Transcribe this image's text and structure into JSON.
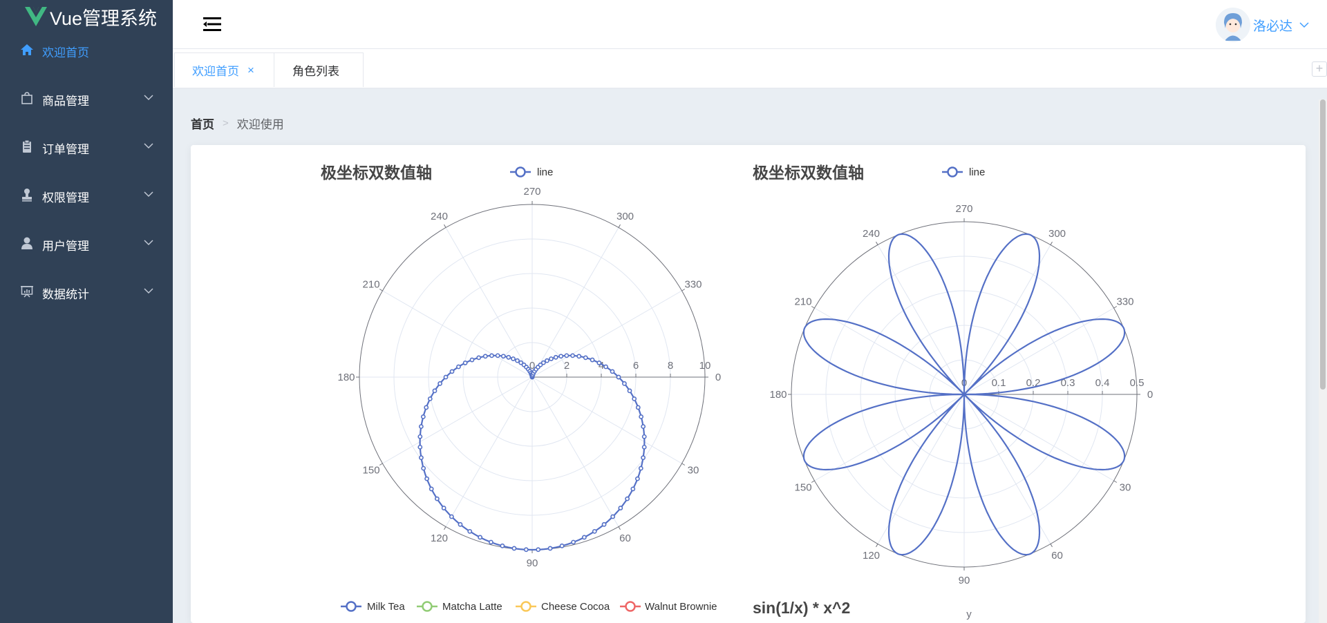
{
  "app": {
    "title": "Vue管理系统"
  },
  "sidebar": {
    "items": [
      {
        "label": "欢迎首页",
        "icon": "home-icon",
        "active": true
      },
      {
        "label": "商品管理",
        "icon": "shopping-bag-icon"
      },
      {
        "label": "订单管理",
        "icon": "clipboard-icon"
      },
      {
        "label": "权限管理",
        "icon": "stamp-icon"
      },
      {
        "label": "用户管理",
        "icon": "user-icon"
      },
      {
        "label": "数据统计",
        "icon": "presentation-chart-icon"
      }
    ]
  },
  "header": {
    "user_name": "洛必达"
  },
  "tabs": [
    {
      "label": "欢迎首页",
      "active": true,
      "closable": true
    },
    {
      "label": "角色列表"
    }
  ],
  "breadcrumb": {
    "home": "首页",
    "current": "欢迎使用"
  },
  "colors": {
    "sidebar_bg": "#304156",
    "accent": "#409eff",
    "series": "#5470c6",
    "green": "#91cc75",
    "yellow": "#fac858",
    "red": "#ee6666"
  },
  "chart_data": [
    {
      "type": "line",
      "coordinate_system": "polar",
      "title": "极坐标双数值轴",
      "legend": [
        "line"
      ],
      "radius_axis": {
        "min": 0,
        "max": 10,
        "ticks": [
          "0",
          "2",
          "4",
          "6",
          "8",
          "10"
        ]
      },
      "angle_axis": {
        "min": 0,
        "max": 360,
        "ticks": [
          "0",
          "30",
          "60",
          "90",
          "120",
          "150",
          "180",
          "210",
          "240",
          "270",
          "300",
          "330"
        ]
      },
      "series": [
        {
          "name": "line",
          "formula": "r = 5 + 5·sin(θ), θ in degrees 0..360",
          "symbol": "circle"
        }
      ]
    },
    {
      "type": "line",
      "coordinate_system": "polar",
      "title": "极坐标双数值轴",
      "legend": [
        "line"
      ],
      "radius_axis": {
        "min": 0,
        "max": 0.5,
        "ticks": [
          "0",
          "0.1",
          "0.2",
          "0.3",
          "0.4",
          "0.5"
        ]
      },
      "angle_axis": {
        "min": 0,
        "max": 360,
        "ticks": [
          "0",
          "30",
          "60",
          "90",
          "120",
          "150",
          "180",
          "210",
          "240",
          "270",
          "300",
          "330"
        ]
      },
      "series": [
        {
          "name": "line",
          "formula": "r = |sin(4θ)| / 2 (eight petals), smooth"
        }
      ]
    },
    {
      "type": "line",
      "title": "",
      "legend": [
        "Milk Tea",
        "Matcha Latte",
        "Cheese Cocoa",
        "Walnut Brownie"
      ]
    },
    {
      "type": "line",
      "title": "sin(1/x) * x^2",
      "ylabel": "y"
    }
  ]
}
